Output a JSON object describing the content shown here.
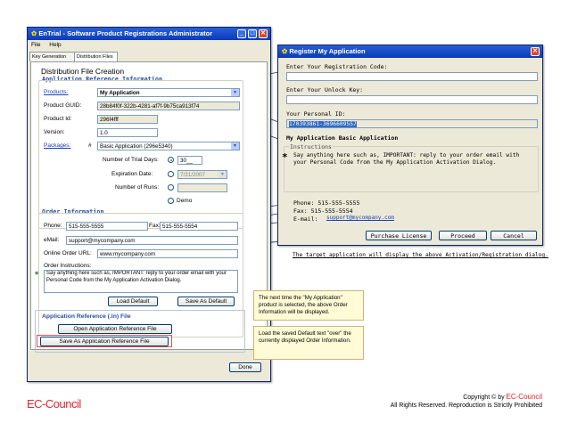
{
  "main_window": {
    "title": "EnTrial - Software Product Registrations Administrator",
    "menu": [
      "File",
      "Help"
    ],
    "tabs": [
      "Key Generation",
      "Distribution Files"
    ],
    "heading": "Distribution File Creation",
    "app_ref_section": "Application Reference Information",
    "products_label": "Products:",
    "products_value": "My Application",
    "product_guid_label": "Product GUID:",
    "product_guid_value": "28b84f0f-322b-4281-af7f-9b75ca913f74",
    "product_id_label": "Product Id:",
    "product_id_value": "296f4fff",
    "version_label": "Version:",
    "version_value": "1.0",
    "packages_label": "Packages:",
    "packages_hash": "#",
    "packages_value": "Basic Application (296e5340)",
    "trial_days_label": "Number of Trial Days:",
    "trial_days_value": "30__",
    "expiration_label": "Expiration Date:",
    "expiration_value": "7/21/2007",
    "runs_label": "Number of Runs:",
    "demo_label": "Demo",
    "order_section": "Order Information",
    "phone_label": "Phone:",
    "phone_value": "515-555-5555",
    "fax_label": "Fax:",
    "fax_value": "515-555-5554",
    "email_label": "eMail:",
    "email_value": "support@mycompany.com",
    "order_url_label": "Online Order URL:",
    "order_url_value": "www.mycompany.com",
    "order_instr_label": "Order Instructions:",
    "order_instr_star": "*",
    "order_instr_value": "Say anything here such as, IMPORTANT: reply to your order email with your Personal Code from the My Application Activation Dialog.",
    "load_default": "Load Default",
    "save_as_default": "Save As Default",
    "ref_file_section": "Application Reference (.ln) File",
    "open_ref_file": "Open Application Reference File",
    "save_as_ref_file": "Save As Application Reference File",
    "done": "Done"
  },
  "register_dialog": {
    "title": "Register My Application",
    "reg_code_label": "Enter Your Registration Code:",
    "unlock_key_label": "Enter Your Unlock Key:",
    "personal_id_label": "Your Personal ID:",
    "personal_id_value": "170393861-3696609557",
    "app_name": "My Application Basic Application",
    "instructions_label": "Instructions",
    "instructions_star": "*",
    "instructions_text": "Say anything here such as, IMPORTANT: reply to your order email with your Personal Code from the My Application Activation Dialog.",
    "phone": "Phone: 515-555-5555",
    "fax": "Fax: 515-555-5554",
    "email_label": "E-mail:",
    "email_link": "support@mycompany.com",
    "purchase_license": "Purchase License",
    "proceed": "Proceed",
    "cancel": "Cancel"
  },
  "caption": "The target application will display the above Activation/Registration dialog.",
  "note1": "The next time the \"My Application\" product is selected, the above Order Information will be displayed.",
  "note2": "Load the saved Default text \"over\" the currently displayed Order Information.",
  "footer": {
    "logo": "EC-Council",
    "copyright_prefix": "Copyright © by ",
    "copyright_brand": "EC-Council",
    "rights": "All Rights Reserved. Reproduction is Strictly Prohibited"
  },
  "colors": {
    "brand_red": "#e8222e",
    "title_blue": "#0a3ab8",
    "section_blue": "#2a4ea0",
    "highlight_red": "#e05050"
  }
}
